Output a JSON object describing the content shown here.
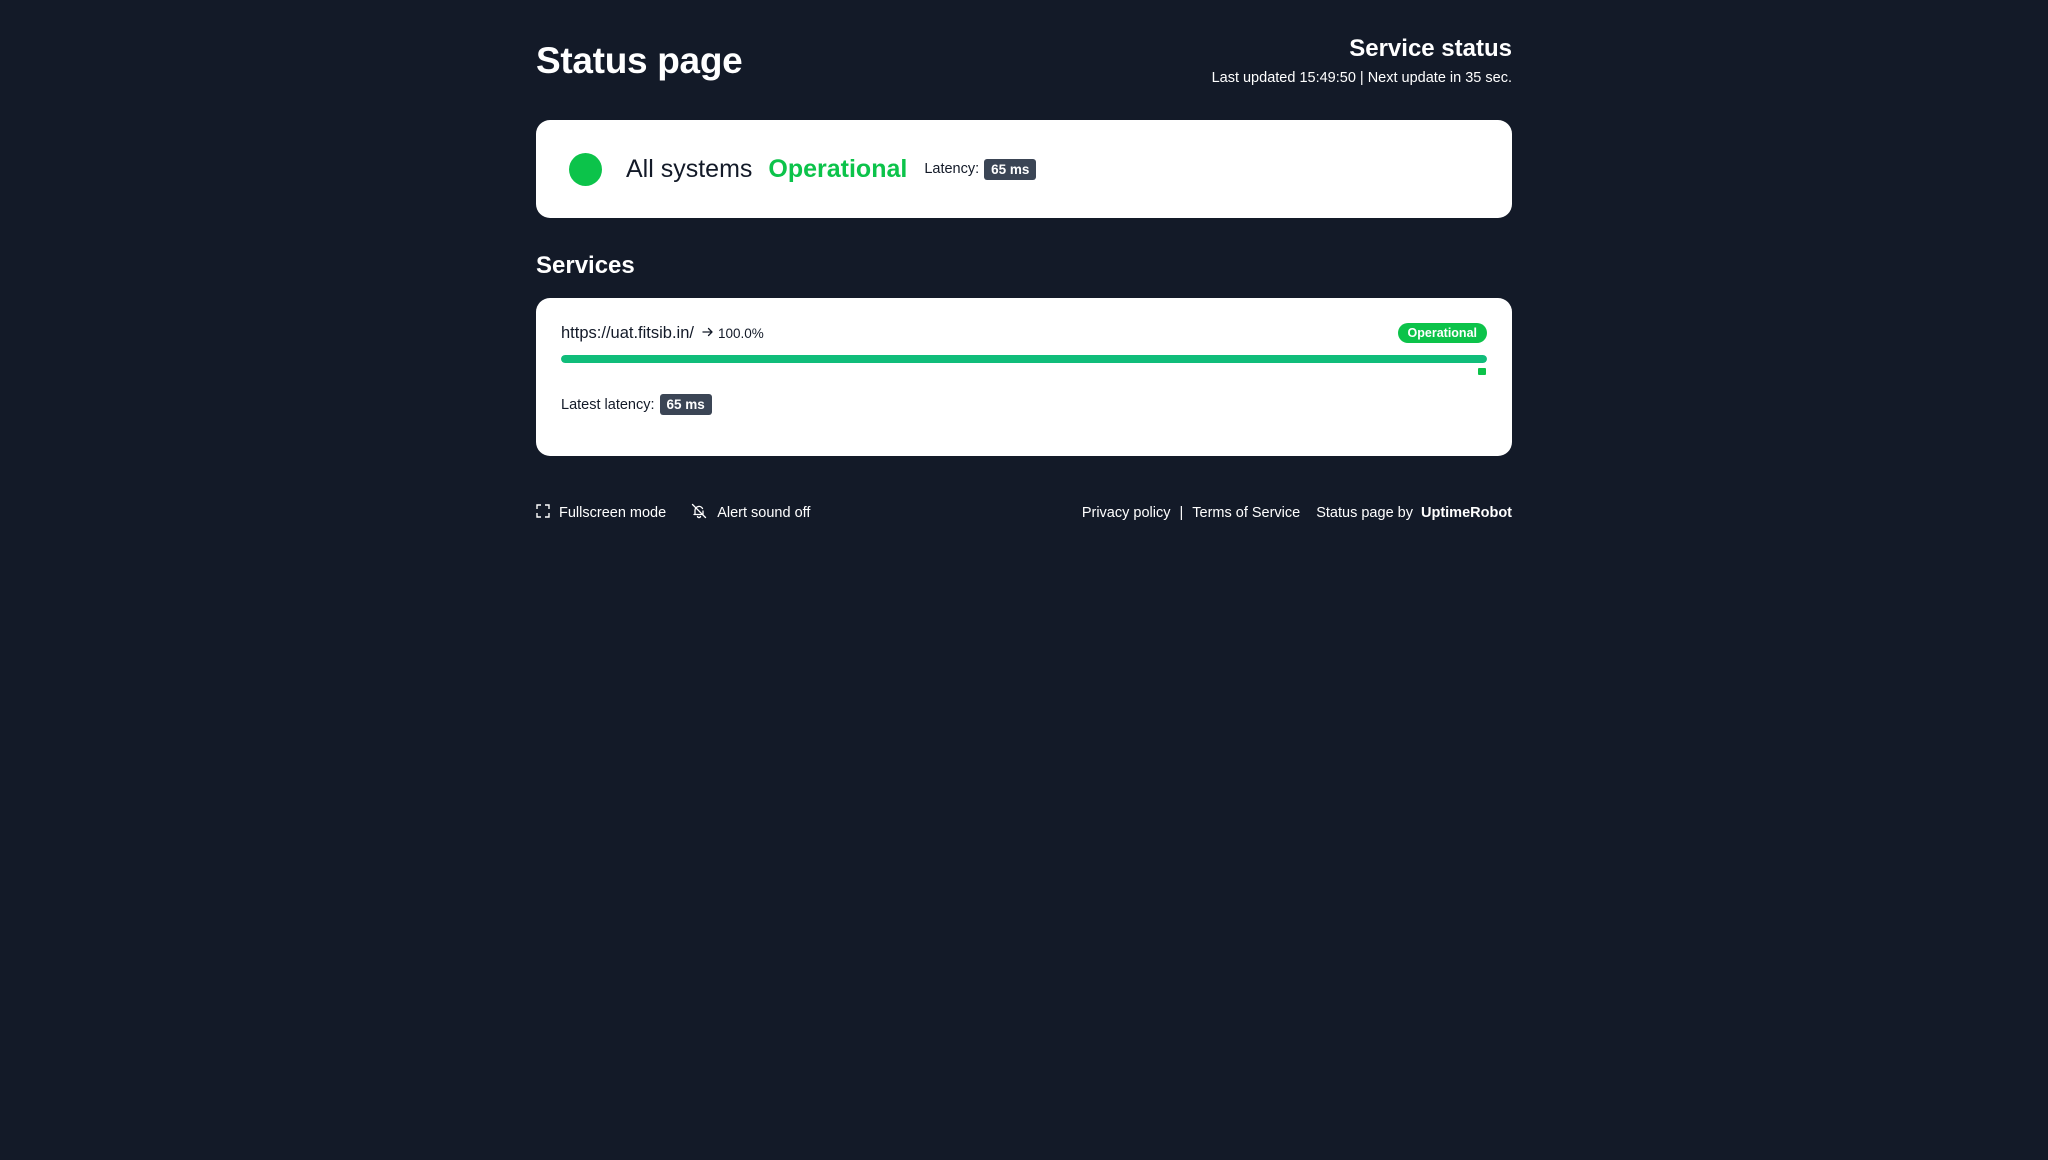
{
  "header": {
    "title": "Status page",
    "service_status_title": "Service status",
    "update_line": "Last updated 15:49:50 | Next update in 35 sec."
  },
  "overall": {
    "label": "All systems",
    "status": "Operational",
    "latency_label": "Latency:",
    "latency_value": "65 ms",
    "status_color": "#0cc34a"
  },
  "services": {
    "heading": "Services",
    "items": [
      {
        "url": "https://uat.fitsib.in/",
        "arrow_icon": "arrow-right-icon",
        "uptime": "100.0%",
        "uptime_fraction": 1.0,
        "status": "Operational",
        "latency_label": "Latest latency:",
        "latency_value": "65 ms"
      }
    ]
  },
  "footer": {
    "fullscreen_icon": "fullscreen-icon",
    "fullscreen_label": "Fullscreen mode",
    "alert_icon": "bell-off-icon",
    "alert_label": "Alert sound off",
    "privacy_label": "Privacy policy",
    "separator": "|",
    "terms_label": "Terms of Service",
    "by_label": "Status page by",
    "brand_label": "UptimeRobot"
  },
  "colors": {
    "background": "#131a28",
    "accent_green": "#0cc34a",
    "bar_green": "#10bd7a",
    "badge_dark": "#3b4555"
  }
}
